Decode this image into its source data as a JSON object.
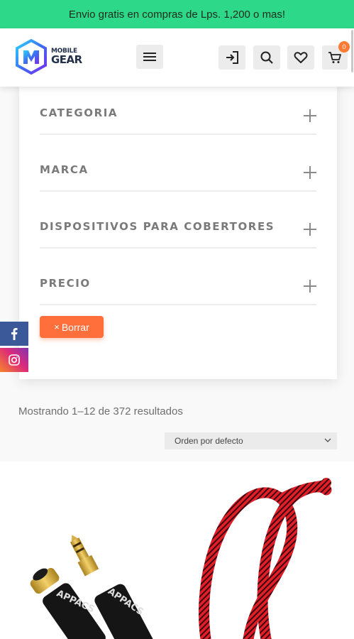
{
  "promo": {
    "text": "Envio gratis en compras de Lps. 1,200 o mas!"
  },
  "header": {
    "logo_line1": "MOBILE",
    "logo_line2": "GEAR",
    "cart_count": "0",
    "icons": [
      "menu-icon",
      "login-icon",
      "search-icon",
      "heart-icon",
      "cart-icon"
    ]
  },
  "filters": {
    "items": [
      {
        "label": "CATEGORIA"
      },
      {
        "label": "MARCA"
      },
      {
        "label": "DISPOSITIVOS PARA COBERTORES"
      },
      {
        "label": "PRECIO"
      }
    ],
    "clear_label": "Borrar",
    "clear_icon": "×"
  },
  "social": [
    "facebook-icon",
    "instagram-icon"
  ],
  "results": {
    "count_text": "Mostrando 1–12 de 372 resultados",
    "sort_selected": "Orden por defecto"
  },
  "product": {
    "brand_text_1": "APPACS",
    "brand_text_2": "APPACS"
  },
  "colors": {
    "promo": "#2dd888",
    "accent": "#ff6f3c",
    "facebook": "#3b5998"
  }
}
